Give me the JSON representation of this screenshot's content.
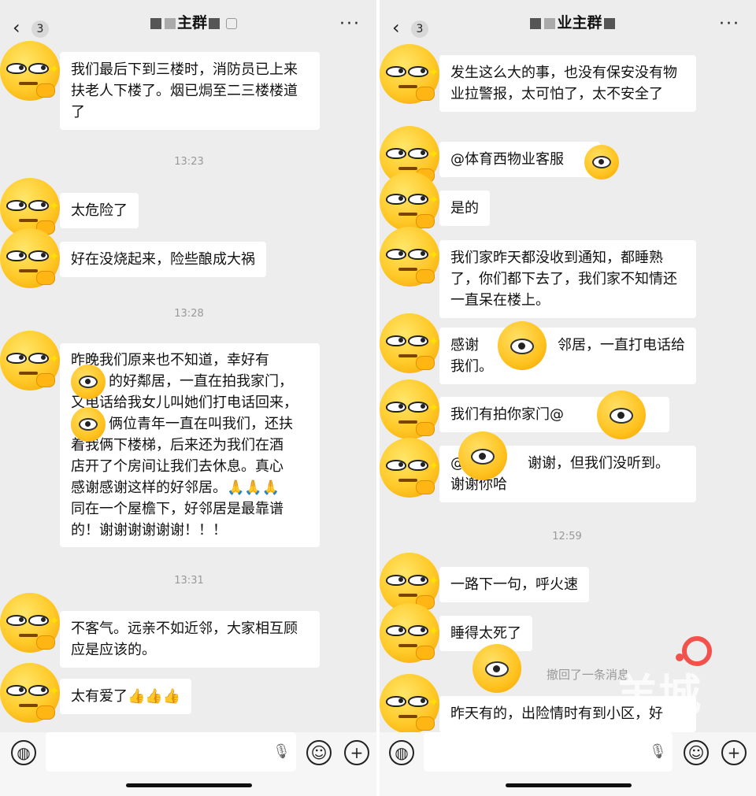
{
  "left": {
    "header": {
      "back_count": "3",
      "title": "主群",
      "more": "···"
    },
    "items": [
      {
        "type": "msg",
        "text": "我们最后下到三楼时，消防员已上来扶老人下楼了。烟已焗至二三楼楼道了"
      },
      {
        "type": "time",
        "text": "13:23"
      },
      {
        "type": "msg",
        "text": "太危险了"
      },
      {
        "type": "msg",
        "text": "好在没烧起来，险些酿成大祸"
      },
      {
        "type": "time",
        "text": "13:28"
      },
      {
        "type": "msg",
        "lines": [
          "昨晚我们原来也不知道，幸好有",
          "的好鄰居，一直在拍我家门，",
          "又电话给我女儿叫她们打电话回来，",
          "俩位青年一直在叫我们，还扶",
          "着我俩下楼梯，后来还为我们在酒",
          "店开了个房间让我们去休息。真心",
          "感谢感谢这样的好邻居。🙏🙏🙏",
          "同在一个屋檐下，好邻居是最靠谱",
          "的！谢谢谢谢谢谢！！！"
        ]
      },
      {
        "type": "time",
        "text": "13:31"
      },
      {
        "type": "msg",
        "text": "不客气。远亲不如近邻，大家相互顾应是应该的。"
      },
      {
        "type": "msg",
        "text": "太有爱了👍👍👍"
      }
    ]
  },
  "right": {
    "header": {
      "back_count": "3",
      "title": "业主群",
      "more": "···"
    },
    "items": [
      {
        "type": "msg",
        "text": "发生这么大的事，也没有保安没有物业拉警报，太可怕了，太不安全了"
      },
      {
        "type": "msg",
        "text": "@体育西物业客服"
      },
      {
        "type": "msg",
        "text": "是的"
      },
      {
        "type": "msg",
        "text": "我们家昨天都没收到通知，都睡熟了，你们都下去了，我们家不知情还一直呆在楼上。"
      },
      {
        "type": "msg",
        "text_a": "感谢",
        "text_b": "邻居，一直打电话给我们。"
      },
      {
        "type": "msg",
        "text": "我们有拍你家门@"
      },
      {
        "type": "msg",
        "text_a": "@",
        "text_b": "谢谢，但我们没听到。",
        "text_c": "谢谢你哈"
      },
      {
        "type": "time",
        "text": "12:59"
      },
      {
        "type": "msg",
        "text": "一路下一句，呼火速"
      },
      {
        "type": "msg",
        "text": "睡得太死了"
      },
      {
        "type": "recall",
        "text": "撤回了一条消息"
      },
      {
        "type": "msg",
        "text": "昨天有的，出险情时有到小区，好"
      }
    ],
    "watermark": "羊城"
  },
  "icons": {
    "voice": "voice-icon",
    "emoji": "emoji-icon",
    "plus": "plus-icon",
    "mic": "microphone-icon",
    "back": "chevron-left-icon",
    "more": "more-icon"
  }
}
